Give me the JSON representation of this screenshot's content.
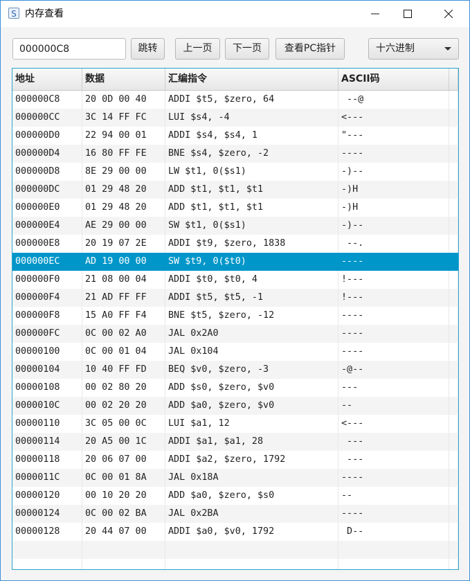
{
  "window": {
    "title": "内存查看",
    "app_icon_glyph": "S",
    "controls": [
      "minimize",
      "maximize",
      "close"
    ]
  },
  "toolbar": {
    "address_value": "000000C8",
    "jump_label": "跳转",
    "prev_label": "上一页",
    "next_label": "下一页",
    "pc_label": "查看PC指针",
    "format_selected": "十六进制"
  },
  "table": {
    "columns": [
      "地址",
      "数据",
      "汇编指令",
      "ASCII码"
    ],
    "selected_index": 9,
    "rows": [
      {
        "addr": "000000C8",
        "data": "20 0D 00 40",
        "asm": "ADDI $t5, $zero, 64",
        "ascii": " --@"
      },
      {
        "addr": "000000CC",
        "data": "3C 14 FF FC",
        "asm": "LUI $s4, -4",
        "ascii": "<---"
      },
      {
        "addr": "000000D0",
        "data": "22 94 00 01",
        "asm": "ADDI $s4, $s4, 1",
        "ascii": "\"---"
      },
      {
        "addr": "000000D4",
        "data": "16 80 FF FE",
        "asm": "BNE $s4, $zero, -2",
        "ascii": "----"
      },
      {
        "addr": "000000D8",
        "data": "8E 29 00 00",
        "asm": "LW $t1, 0($s1)",
        "ascii": "-)--"
      },
      {
        "addr": "000000DC",
        "data": "01 29 48 20",
        "asm": "ADD $t1, $t1, $t1",
        "ascii": "-)H "
      },
      {
        "addr": "000000E0",
        "data": "01 29 48 20",
        "asm": "ADD $t1, $t1, $t1",
        "ascii": "-)H "
      },
      {
        "addr": "000000E4",
        "data": "AE 29 00 00",
        "asm": "SW $t1, 0($s1)",
        "ascii": "-)--"
      },
      {
        "addr": "000000E8",
        "data": "20 19 07 2E",
        "asm": "ADDI $t9, $zero, 1838",
        "ascii": " --."
      },
      {
        "addr": "000000EC",
        "data": "AD 19 00 00",
        "asm": "SW $t9, 0($t0)",
        "ascii": "----"
      },
      {
        "addr": "000000F0",
        "data": "21 08 00 04",
        "asm": "ADDI $t0, $t0, 4",
        "ascii": "!---"
      },
      {
        "addr": "000000F4",
        "data": "21 AD FF FF",
        "asm": "ADDI $t5, $t5, -1",
        "ascii": "!---"
      },
      {
        "addr": "000000F8",
        "data": "15 A0 FF F4",
        "asm": "BNE $t5, $zero, -12",
        "ascii": "----"
      },
      {
        "addr": "000000FC",
        "data": "0C 00 02 A0",
        "asm": "JAL 0x2A0",
        "ascii": "----"
      },
      {
        "addr": "00000100",
        "data": "0C 00 01 04",
        "asm": "JAL 0x104",
        "ascii": "----"
      },
      {
        "addr": "00000104",
        "data": "10 40 FF FD",
        "asm": "BEQ $v0, $zero, -3",
        "ascii": "-@--"
      },
      {
        "addr": "00000108",
        "data": "00 02 80 20",
        "asm": "ADD $s0, $zero, $v0",
        "ascii": "--- "
      },
      {
        "addr": "0000010C",
        "data": "00 02 20 20",
        "asm": "ADD $a0, $zero, $v0",
        "ascii": "--  "
      },
      {
        "addr": "00000110",
        "data": "3C 05 00 0C",
        "asm": "LUI $a1, 12",
        "ascii": "<---"
      },
      {
        "addr": "00000114",
        "data": "20 A5 00 1C",
        "asm": "ADDI $a1, $a1, 28",
        "ascii": " ---"
      },
      {
        "addr": "00000118",
        "data": "20 06 07 00",
        "asm": "ADDI $a2, $zero, 1792",
        "ascii": " ---"
      },
      {
        "addr": "0000011C",
        "data": "0C 00 01 8A",
        "asm": "JAL 0x18A",
        "ascii": "----"
      },
      {
        "addr": "00000120",
        "data": "00 10 20 20",
        "asm": "ADD $a0, $zero, $s0",
        "ascii": "--  "
      },
      {
        "addr": "00000124",
        "data": "0C 00 02 BA",
        "asm": "JAL 0x2BA",
        "ascii": "----"
      },
      {
        "addr": "00000128",
        "data": "20 44 07 00",
        "asm": "ADDI $a0, $v0, 1792",
        "ascii": " D--"
      },
      {
        "addr": "",
        "data": "",
        "asm": "",
        "ascii": ""
      },
      {
        "addr": "",
        "data": "",
        "asm": "",
        "ascii": ""
      }
    ]
  },
  "colors": {
    "selection": "#0096c9",
    "window_border": "#3b8fd8",
    "table_border": "#2aa3d0"
  }
}
